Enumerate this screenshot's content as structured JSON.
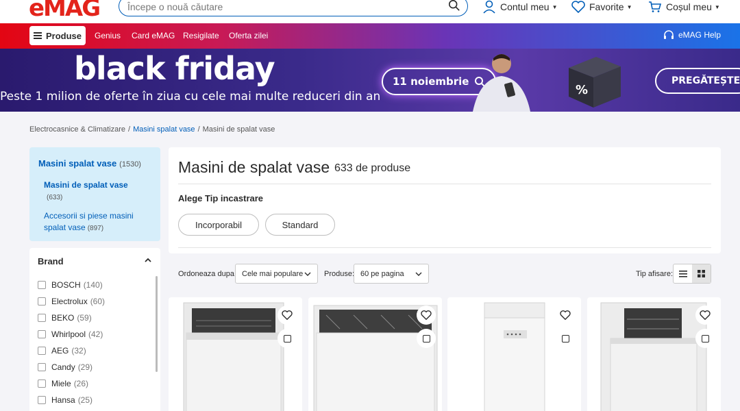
{
  "header": {
    "logo": "eMAG",
    "search_placeholder": "Începe o nouă căutare",
    "account": "Contul meu",
    "favorites": "Favorite",
    "cart": "Coșul meu"
  },
  "nav": {
    "products": "Produse",
    "links": [
      "Genius",
      "Card eMAG",
      "Resigilate",
      "Oferta zilei"
    ],
    "help": "eMAG Help"
  },
  "banner": {
    "title": "black friday",
    "subtitle": "Peste 1 milion de oferte în ziua cu cele mai multe reduceri din an",
    "date": "11 noiembrie",
    "cta": "PREGĂTEȘTE-TE"
  },
  "breadcrumb": [
    "Electrocasnice & Climatizare",
    "Masini spalat vase",
    "Masini de spalat vase"
  ],
  "categories": {
    "title": "Masini spalat vase",
    "title_count": "(1530)",
    "sub1": "Masini de spalat vase",
    "sub1_count": "(633)",
    "sub2": "Accesorii si piese masini spalat vase",
    "sub2_count": "(897)"
  },
  "brand_filter": {
    "title": "Brand",
    "items": [
      {
        "name": "BOSCH",
        "count": "(140)"
      },
      {
        "name": "Electrolux",
        "count": "(60)"
      },
      {
        "name": "BEKO",
        "count": "(59)"
      },
      {
        "name": "Whirlpool",
        "count": "(42)"
      },
      {
        "name": "AEG",
        "count": "(32)"
      },
      {
        "name": "Candy",
        "count": "(29)"
      },
      {
        "name": "Miele",
        "count": "(26)"
      },
      {
        "name": "Hansa",
        "count": "(25)"
      }
    ]
  },
  "main": {
    "title": "Masini de spalat vase",
    "count": "633 de produse",
    "filter_label": "Alege Tip incastrare",
    "pills": [
      "Incorporabil",
      "Standard"
    ]
  },
  "sort": {
    "order_label": "Ordoneaza dupa:",
    "order_value": "Cele mai populare",
    "per_page_label": "Produse:",
    "per_page_value": "60 pe pagina",
    "view_label": "Tip afisare:"
  },
  "colors": {
    "brand_red": "#e3241b",
    "link_blue": "#005eb8",
    "category_bg": "#d6eefa"
  }
}
